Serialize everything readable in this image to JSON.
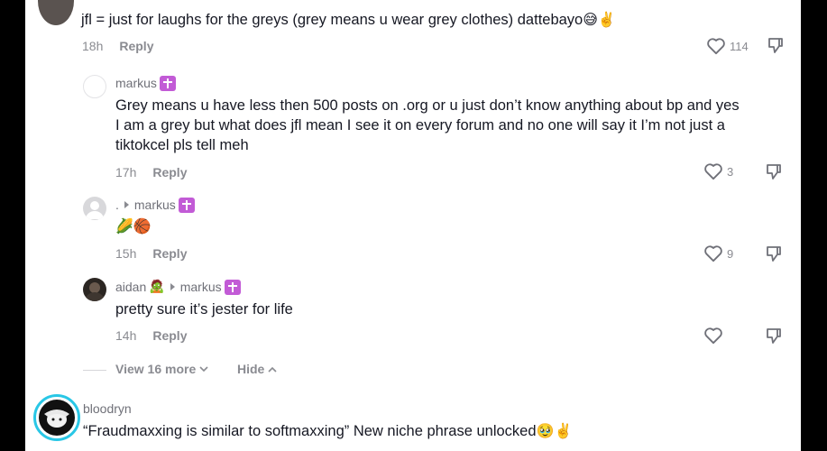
{
  "comments": [
    {
      "text": "jfl = just for laughs for the greys (grey means u wear grey clothes) dattebayo",
      "emoji": "😅✌️",
      "time": "18h",
      "reply": "Reply",
      "likes": "114"
    },
    {
      "username": "markus",
      "text_lines": [
        "Grey means u have less then 500 posts on .org or u just don’t know anything about bp and yes",
        "I am a grey but what does jfl mean I see it on every forum and no one will say it I’m not just a",
        "tiktokcel pls tell meh"
      ],
      "time": "17h",
      "reply": "Reply",
      "likes": "3"
    },
    {
      "username": ".",
      "reply_to": "markus",
      "emoji": "🌽🏀",
      "time": "15h",
      "reply": "Reply",
      "likes": "9"
    },
    {
      "username": "aidan",
      "username_emoji": "🧟",
      "reply_to": "markus",
      "text": "pretty sure it’s jester for life",
      "time": "14h",
      "reply": "Reply",
      "likes": ""
    }
  ],
  "thread_controls": {
    "view_more": "View 16 more",
    "hide": "Hide"
  },
  "next_comment": {
    "username": "bloodryn",
    "text": "“Fraudmaxxing is similar to softmaxxing” New niche phrase unlocked",
    "emoji": "🥹✌️"
  }
}
